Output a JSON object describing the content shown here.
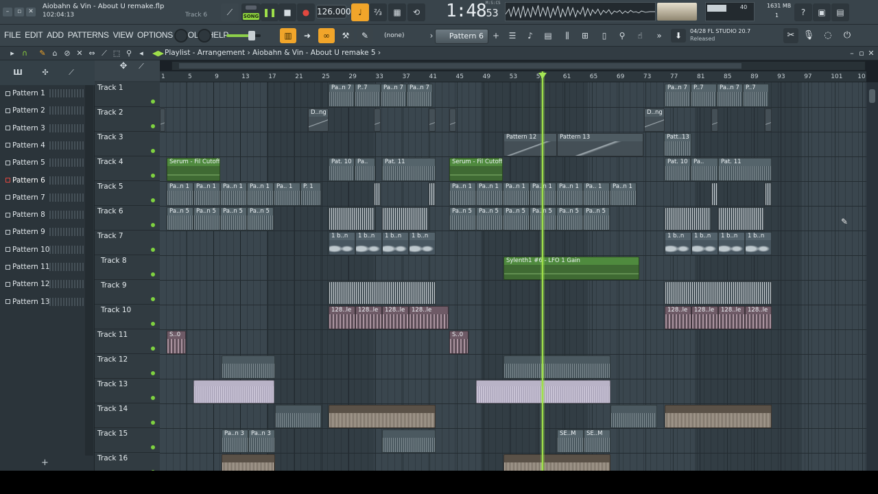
{
  "window": {
    "project_title": "Aiobahn & Vin - About U remake.flp",
    "project_time": "102:04:13",
    "hint_track": "Track 6"
  },
  "transport": {
    "song_label": "SONG",
    "tempo": "126.000",
    "time_main": "1:48",
    "time_small": "53",
    "time_units": "M:S:CS",
    "cpu_value": "40",
    "memory": "1631 MB",
    "polyphony": "1"
  },
  "menu": [
    "FILE",
    "EDIT",
    "ADD",
    "PATTERNS",
    "VIEW",
    "OPTIONS",
    "TOOLS",
    "HELP"
  ],
  "toolbar": {
    "snap_value": "(none)",
    "pattern_selector": "Pattern 6",
    "news_date": "04/28",
    "news_title": "FL STUDIO 20.7",
    "news_status": "Released"
  },
  "playlist": {
    "breadcrumb": "Playlist - Arrangement",
    "breadcrumb_sep": "›",
    "project_name": "Aiobahn & Vin - About U remake 5",
    "bar_numbers": [
      "1",
      "5",
      "9",
      "13",
      "17",
      "21",
      "25",
      "29",
      "33",
      "37",
      "41",
      "45",
      "49",
      "53",
      "57",
      "61",
      "65",
      "69",
      "73",
      "77",
      "81",
      "85",
      "89",
      "93",
      "97",
      "101",
      "10"
    ],
    "patterns": [
      "Pattern 1",
      "Pattern 2",
      "Pattern 3",
      "Pattern 4",
      "Pattern 5",
      "Pattern 6",
      "Pattern 7",
      "Pattern 8",
      "Pattern 9",
      "Pattern 10",
      "Pattern 11",
      "Pattern 12",
      "Pattern 13"
    ],
    "selected_pattern_index": 5,
    "tracks": [
      "Track 1",
      "Track 2",
      "Track 3",
      "Track 4",
      "Track 5",
      "Track 6",
      "Track 7",
      "Track 8",
      "Track 9",
      "Track 10",
      "Track 11",
      "Track 12",
      "Track 13",
      "Track 14",
      "Track 15",
      "Track 16"
    ],
    "add_pattern_label": "+"
  },
  "clip_labels": {
    "pat7": "Pa..n 7",
    "p7": "P..7",
    "dng": "D..ng",
    "pattern12": "Pattern 12",
    "pattern13": "Pattern 13",
    "patt13": "Patt..13",
    "serum": "Serum - Fil Cutoff",
    "pat10": "Pat. 10",
    "pa": "Pa..",
    "pat11": "Pat. 11",
    "pan1": "Pa..n 1",
    "pa1": "Pa.. 1",
    "p1": "P. 1",
    "pan5": "Pa..n 5",
    "ibn": "1 b..n",
    "sylenth": "Sylenth1 #6 - LFO 1 Gain",
    "le128": "128..le",
    "s50": "S..0",
    "pan3": "Pa..n 3",
    "sem": "SE..M"
  },
  "colors": {
    "accent_orange": "#f1a52a",
    "accent_green": "#8ed23d",
    "playhead": "#9fe04a"
  }
}
